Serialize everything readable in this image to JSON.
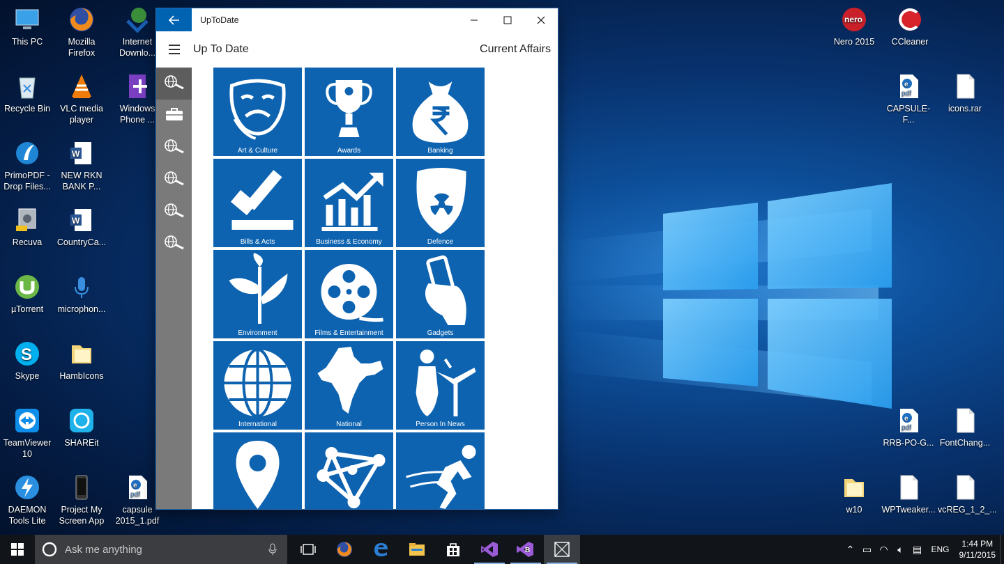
{
  "desktop": {
    "icons_left": [
      {
        "label": "This PC",
        "icon": "this-pc-icon"
      },
      {
        "label": "Mozilla Firefox",
        "icon": "firefox-icon"
      },
      {
        "label": "Internet Downlo...",
        "icon": "internet-download-manager-icon"
      },
      {
        "label": "Recycle Bin",
        "icon": "recycle-bin-icon"
      },
      {
        "label": "VLC media player",
        "icon": "vlc-icon"
      },
      {
        "label": "Windows Phone ...",
        "icon": "windows-phone-icon"
      },
      {
        "label": "PrimoPDF - Drop Files...",
        "icon": "primopdf-icon"
      },
      {
        "label": "NEW RKN BANK P...",
        "icon": "word-document-icon"
      },
      {
        "label": "Recuva",
        "icon": "recuva-icon"
      },
      {
        "label": "CountryCa...",
        "icon": "word-document-icon"
      },
      {
        "label": "µTorrent",
        "icon": "utorrent-icon"
      },
      {
        "label": "microphon...",
        "icon": "microphone-icon"
      },
      {
        "label": "Skype",
        "icon": "skype-icon"
      },
      {
        "label": "HambIcons",
        "icon": "folder-icon"
      },
      {
        "label": "TeamViewer 10",
        "icon": "teamviewer-icon"
      },
      {
        "label": "SHAREit",
        "icon": "shareit-icon"
      },
      {
        "label": "DAEMON Tools Lite",
        "icon": "daemon-tools-icon"
      },
      {
        "label": "Project My Screen App",
        "icon": "project-my-screen-icon"
      },
      {
        "label": "capsule 2015_1.pdf",
        "icon": "pdf-file-icon"
      }
    ],
    "icons_right": [
      {
        "label": "Nero 2015",
        "icon": "nero-icon"
      },
      {
        "label": "CCleaner",
        "icon": "ccleaner-icon"
      },
      {
        "label": "CAPSULE-F...",
        "icon": "pdf-file-icon"
      },
      {
        "label": "icons.rar",
        "icon": "file-icon"
      },
      {
        "label": "RRB-PO-G...",
        "icon": "pdf-file-icon"
      },
      {
        "label": "FontChang...",
        "icon": "file-icon"
      },
      {
        "label": "w10",
        "icon": "folder-icon"
      },
      {
        "label": "WPTweaker...",
        "icon": "file-icon"
      },
      {
        "label": "vcREG_1_2_...",
        "icon": "file-icon"
      }
    ]
  },
  "app": {
    "window_title": "UpToDate",
    "header_title": "Up To Date",
    "header_right": "Current Affairs",
    "sidebar_icons": [
      "globe-search-icon",
      "briefcase-icon",
      "globe-search-icon",
      "globe-search-icon",
      "globe-search-icon",
      "globe-search-icon"
    ],
    "tiles": [
      {
        "label": "Art & Culture",
        "icon": "theater-masks-icon"
      },
      {
        "label": "Awards",
        "icon": "trophy-icon"
      },
      {
        "label": "Banking",
        "icon": "money-bag-icon"
      },
      {
        "label": "Bills & Acts",
        "icon": "gavel-icon"
      },
      {
        "label": "Business & Economy",
        "icon": "growth-chart-icon"
      },
      {
        "label": "Defence",
        "icon": "shield-icon"
      },
      {
        "label": "Environment",
        "icon": "plant-icon"
      },
      {
        "label": "Films & Entertainment",
        "icon": "film-reel-icon"
      },
      {
        "label": "Gadgets",
        "icon": "phone-in-hand-icon"
      },
      {
        "label": "International",
        "icon": "globe-icon"
      },
      {
        "label": "National",
        "icon": "india-map-icon"
      },
      {
        "label": "Person In News",
        "icon": "speaker-podium-icon"
      },
      {
        "label": "",
        "icon": "location-pin-icon"
      },
      {
        "label": "",
        "icon": "science-network-icon"
      },
      {
        "label": "",
        "icon": "sports-runner-icon"
      }
    ],
    "accent": "#0d63b0"
  },
  "taskbar": {
    "search_placeholder": "Ask me anything",
    "language": "ENG",
    "time": "1:44 PM",
    "date": "9/11/2015"
  }
}
